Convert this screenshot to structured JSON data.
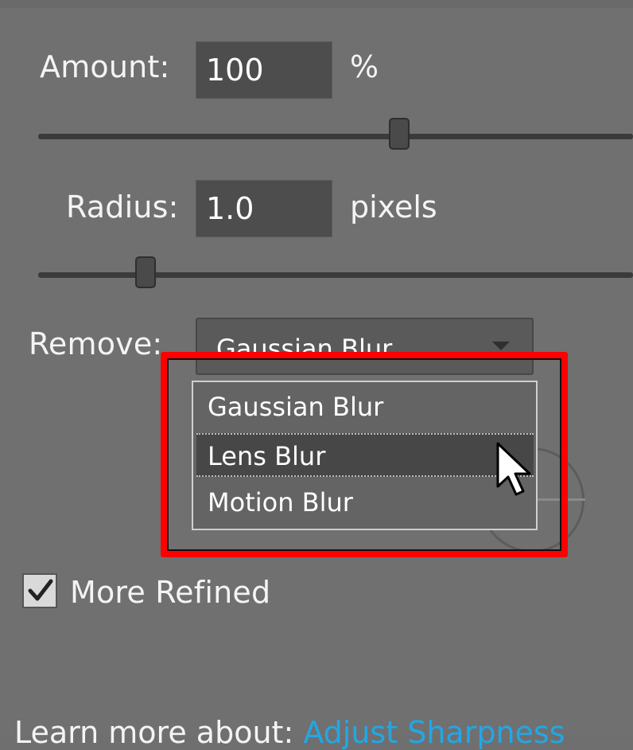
{
  "amount": {
    "label": "Amount:",
    "value": "100",
    "unit": "%",
    "slider_fraction": 0.59
  },
  "radius": {
    "label": "Radius:",
    "value": "1.0",
    "unit": "pixels",
    "slider_fraction": 0.17
  },
  "remove": {
    "label": "Remove:",
    "selected": "Gaussian Blur",
    "options": [
      "Gaussian Blur",
      "Lens Blur",
      "Motion Blur"
    ],
    "highlighted_option": "Lens Blur"
  },
  "more_refined": {
    "label": "More Refined",
    "checked": true
  },
  "footer": {
    "prefix": "Learn more about:",
    "link": "Adjust Sharpness"
  },
  "colors": {
    "highlight_box": "#ff0000",
    "link": "#22a7e6",
    "panel": "#707070"
  }
}
